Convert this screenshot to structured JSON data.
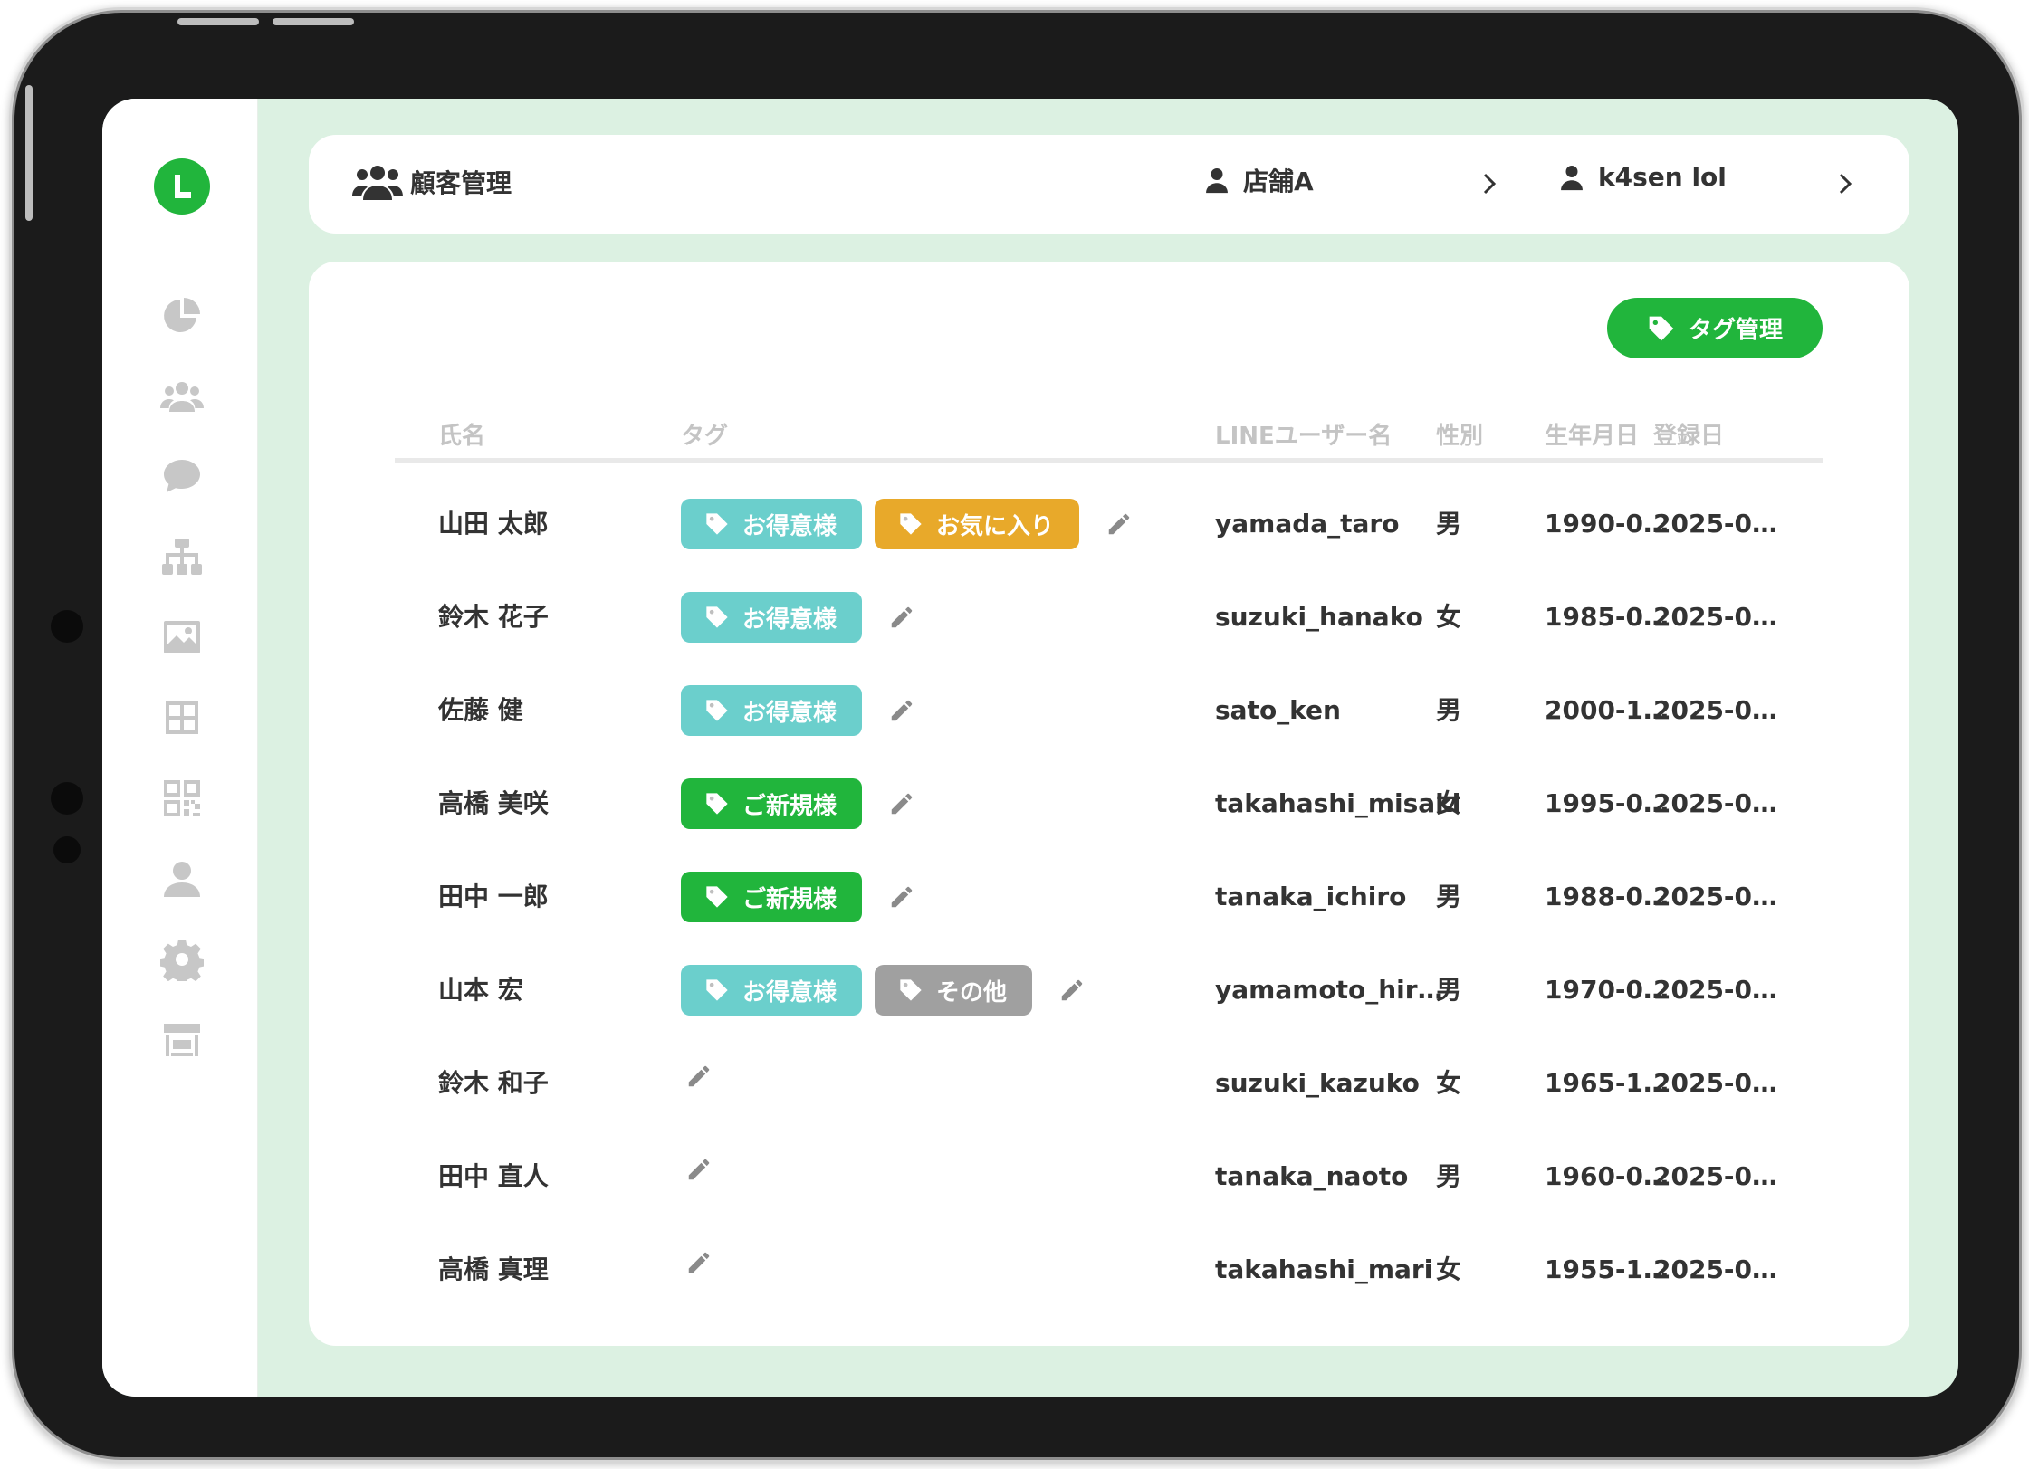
{
  "app": {
    "page_title": "顧客管理",
    "store_name": "店舗A",
    "user_name": "k4sen lol",
    "tag_manage_label": "タグ管理"
  },
  "sidebar_icons": [
    "logo-l-icon",
    "pie-chart-icon",
    "users-icon",
    "chat-bubble-icon",
    "sitemap-icon",
    "image-icon",
    "grid-icon",
    "qr-code-icon",
    "user-icon",
    "gear-icon",
    "store-icon"
  ],
  "colors": {
    "brand": "#21b53c",
    "tag_valued": "#6bcfcc",
    "tag_favorite": "#e8a92a",
    "tag_new": "#21b53c",
    "tag_other": "#a0a0a0",
    "background": "#dcf1e2"
  },
  "table": {
    "headers": {
      "name": "氏名",
      "tag": "タグ",
      "line_user": "LINEユーザー名",
      "gender": "性別",
      "birthday": "生年月日",
      "registered": "登録日"
    },
    "rows": [
      {
        "name": "山田 太郎",
        "tags": [
          {
            "label": "お得意様",
            "color": "#6bcfcc"
          },
          {
            "label": "お気に入り",
            "color": "#e8a92a"
          }
        ],
        "line_user": "yamada_taro",
        "gender": "男",
        "birthday": "1990-0…",
        "registered": "2025-0…"
      },
      {
        "name": "鈴木 花子",
        "tags": [
          {
            "label": "お得意様",
            "color": "#6bcfcc"
          }
        ],
        "line_user": "suzuki_hanako",
        "gender": "女",
        "birthday": "1985-0…",
        "registered": "2025-0…"
      },
      {
        "name": "佐藤 健",
        "tags": [
          {
            "label": "お得意様",
            "color": "#6bcfcc"
          }
        ],
        "line_user": "sato_ken",
        "gender": "男",
        "birthday": "2000-1…",
        "registered": "2025-0…"
      },
      {
        "name": "高橋 美咲",
        "tags": [
          {
            "label": "ご新規様",
            "color": "#21b53c"
          }
        ],
        "line_user": "takahashi_misaki",
        "gender": "女",
        "birthday": "1995-0…",
        "registered": "2025-0…"
      },
      {
        "name": "田中 一郎",
        "tags": [
          {
            "label": "ご新規様",
            "color": "#21b53c"
          }
        ],
        "line_user": "tanaka_ichiro",
        "gender": "男",
        "birthday": "1988-0…",
        "registered": "2025-0…"
      },
      {
        "name": "山本 宏",
        "tags": [
          {
            "label": "お得意様",
            "color": "#6bcfcc"
          },
          {
            "label": "その他",
            "color": "#a0a0a0"
          }
        ],
        "line_user": "yamamoto_hir…",
        "gender": "男",
        "birthday": "1970-0…",
        "registered": "2025-0…"
      },
      {
        "name": "鈴木 和子",
        "tags": [],
        "line_user": "suzuki_kazuko",
        "gender": "女",
        "birthday": "1965-1…",
        "registered": "2025-0…"
      },
      {
        "name": "田中 直人",
        "tags": [],
        "line_user": "tanaka_naoto",
        "gender": "男",
        "birthday": "1960-0…",
        "registered": "2025-0…"
      },
      {
        "name": "高橋 真理",
        "tags": [],
        "line_user": "takahashi_mari",
        "gender": "女",
        "birthday": "1955-1…",
        "registered": "2025-0…"
      }
    ]
  }
}
